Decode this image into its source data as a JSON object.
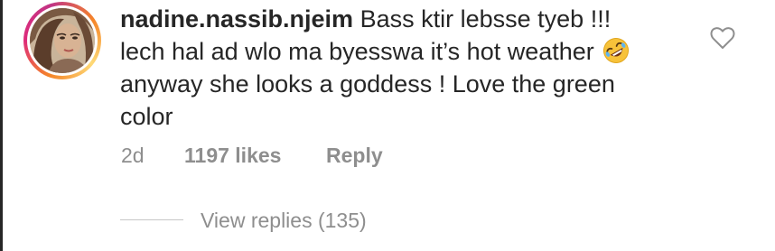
{
  "comment": {
    "username": "nadine.nassib.njeim",
    "text_line1": "Bass ktir lebsse tyeb !!!",
    "text_line2": "lech hal ad wlo ma byesswa it’s hot weather",
    "emoji_icon": "rolling-on-floor-laughing-emoji",
    "text_line3": "anyway she looks a goddess ! Love the green",
    "text_line4": "color",
    "time_ago": "2d",
    "likes": "1197 likes",
    "reply_label": "Reply",
    "view_replies_label": "View replies (135)",
    "like_icon": "heart-outline-icon"
  },
  "colors": {
    "text_primary": "#262626",
    "text_secondary": "#8e8e8e",
    "story_ring_gradient": [
      "#f58529",
      "#dd2a7b",
      "#c13584",
      "#feda77"
    ],
    "background": "#ffffff"
  }
}
